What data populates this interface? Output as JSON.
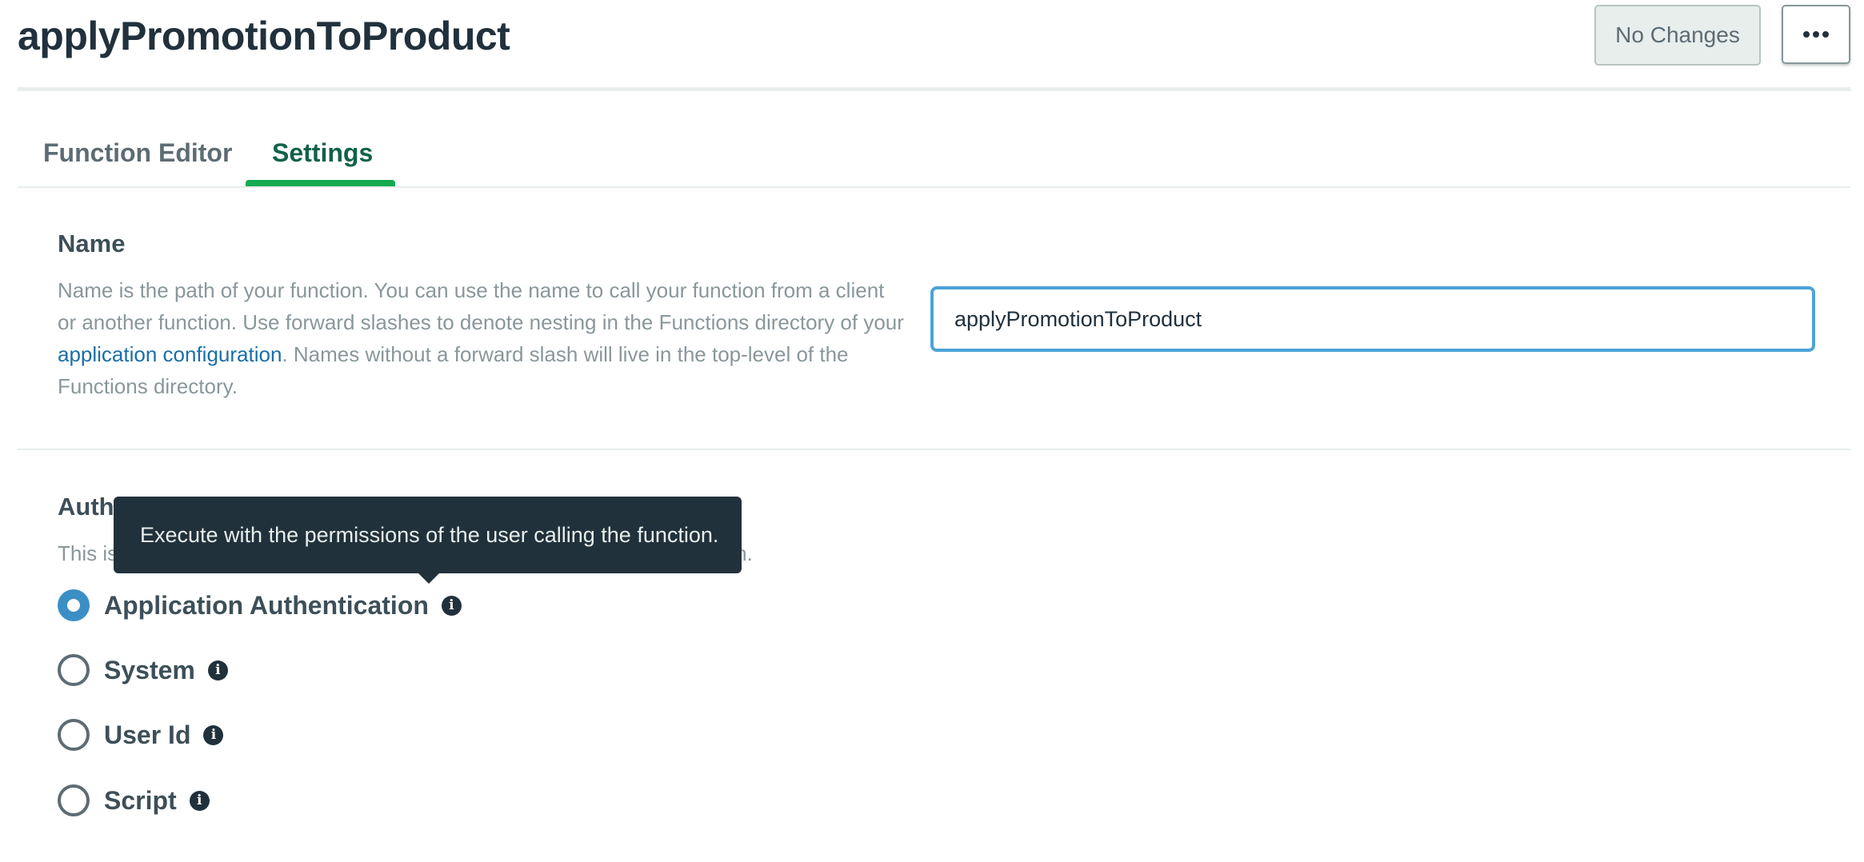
{
  "header": {
    "title": "applyPromotionToProduct",
    "no_changes_label": "No Changes",
    "more_icon": "ellipsis-icon"
  },
  "tabs": [
    {
      "label": "Function Editor",
      "active": false
    },
    {
      "label": "Settings",
      "active": true
    }
  ],
  "name_section": {
    "heading": "Name",
    "description_before_link": "Name is the path of your function. You can use the name to call your function from a client or another function. Use forward slashes to denote nesting in the Functions directory of your ",
    "link_text": "application configuration",
    "description_after_link": ". Names without a forward slash will live in the top-level of the Functions directory.",
    "input_value": "applyPromotionToProduct"
  },
  "auth_section": {
    "heading_visible": "Auth",
    "description_visible_start": "This is",
    "description_visible_end": "n.",
    "options": [
      {
        "label": "Application Authentication",
        "selected": true
      },
      {
        "label": "System",
        "selected": false
      },
      {
        "label": "User Id",
        "selected": false
      },
      {
        "label": "Script",
        "selected": false
      }
    ],
    "info_icon_glyph": "i"
  },
  "tooltip": {
    "text": "Execute with the permissions of the user calling the function."
  },
  "colors": {
    "accent_green": "#13aa52",
    "active_tab_text": "#116149",
    "input_focus_border": "#4ba3d9",
    "radio_selected": "#3b8fc4",
    "link": "#1a6fa8",
    "tooltip_bg": "#21313c"
  }
}
